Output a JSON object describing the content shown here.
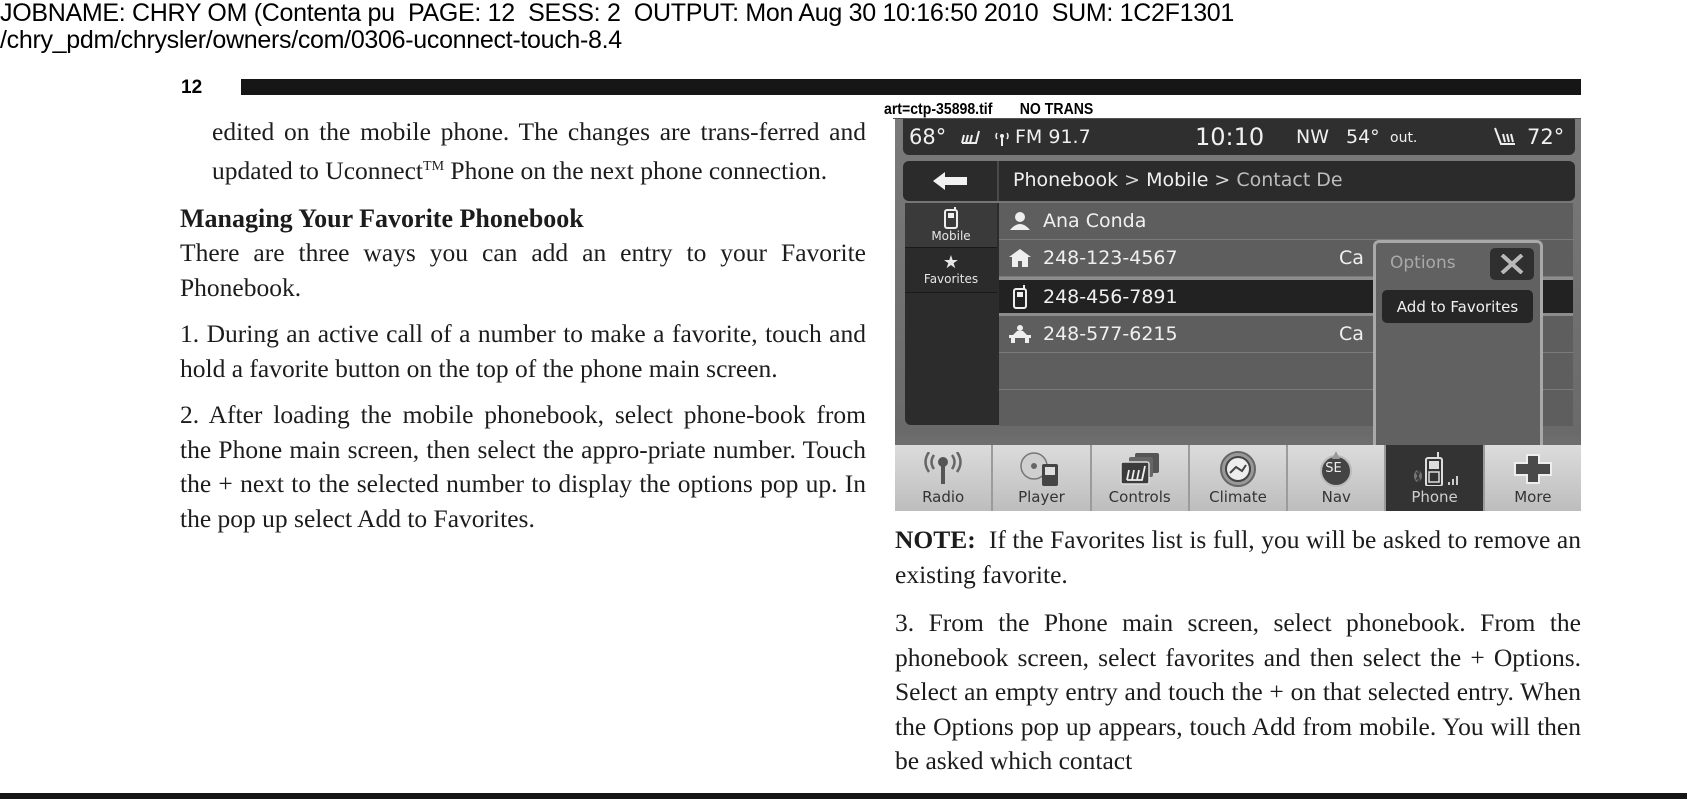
{
  "print_header": {
    "line1": "JOBNAME: CHRY OM (Contenta pu  PAGE: 12  SESS: 2  OUTPUT: Mon Aug 30 10:16:50 2010  SUM: 1C2F1301",
    "line2": "/chry_pdm/chrysler/owners/com/0306-uconnect-touch-8.4"
  },
  "page_number": "12",
  "art_label": "art=ctp-35898.tif       NO TRANS",
  "left_column": {
    "intro_paragraph": {
      "before_tm": "edited on the mobile phone. The changes are trans-ferred and updated to Uconnect",
      "tm": "TM",
      "after_tm": " Phone on the next phone connection."
    },
    "heading": "Managing Your Favorite Phonebook",
    "lead": "There are three ways you can add an entry to your Favorite Phonebook.",
    "step1": "1.  During an active call of a number to make a favorite, touch and hold a favorite button on the top of the phone main screen.",
    "step2": "2. After loading the mobile phonebook, select phone-book from the Phone main screen, then select the appro-priate number. Touch the + next to the selected number to display the options pop up. In the pop up select Add to Favorites."
  },
  "right_column": {
    "note_label": "NOTE:",
    "note_text": "  If the Favorites list is full, you will be asked to remove an existing favorite.",
    "step3": "3.  From the Phone main screen, select phonebook. From the phonebook screen, select favorites and then select the + Options. Select an empty entry and touch the + on that selected entry. When the Options pop up appears, touch Add from mobile. You will then be asked which contact"
  },
  "screen": {
    "status": {
      "driver_temp": "68°",
      "radio": "FM 91.7",
      "time": "10:10",
      "compass": "NW",
      "outside_temp": "54°",
      "outside_label": "out.",
      "passenger_temp": "72°"
    },
    "breadcrumb": {
      "items": [
        "Phonebook",
        "Mobile",
        "Contact De"
      ],
      "separator": ">"
    },
    "side_tabs": [
      {
        "label": "Mobile",
        "icon": "mobile-phone-icon"
      },
      {
        "label": "Favorites",
        "icon": "star-icon"
      }
    ],
    "contact_rows": [
      {
        "icon": "person-icon",
        "text": "Ana Conda",
        "trailing": ""
      },
      {
        "icon": "home-icon",
        "text": "248-123-4567",
        "trailing": "Ca"
      },
      {
        "icon": "mobile-phone-icon",
        "text": "248-456-7891",
        "trailing": "",
        "selected": true
      },
      {
        "icon": "work-icon",
        "text": "248-577-6215",
        "trailing": "Ca"
      }
    ],
    "popup": {
      "title": "Options",
      "close_icon": "close-icon",
      "action": "Add to Favorites"
    },
    "dock": [
      {
        "label": "Radio",
        "icon": "radio-antenna-icon"
      },
      {
        "label": "Player",
        "icon": "disc-player-icon"
      },
      {
        "label": "Controls",
        "icon": "seat-controls-icon"
      },
      {
        "label": "Climate",
        "icon": "climate-icon"
      },
      {
        "label": "Nav",
        "icon": "compass-icon",
        "icon_text": "SE"
      },
      {
        "label": "Phone",
        "icon": "phone-icon",
        "active": true
      },
      {
        "label": "More",
        "icon": "plus-icon"
      }
    ]
  }
}
